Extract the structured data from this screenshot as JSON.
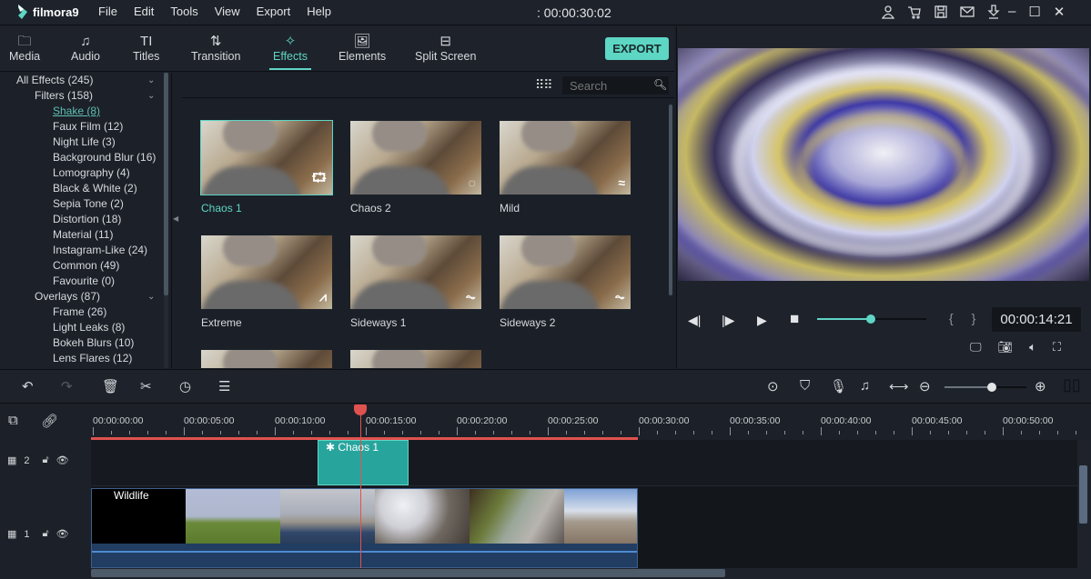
{
  "app": {
    "name": "filmora9",
    "project_duration": ": 00:00:30:02"
  },
  "menu": [
    "File",
    "Edit",
    "Tools",
    "View",
    "Export",
    "Help"
  ],
  "top_icons": [
    "account-icon",
    "cart-icon",
    "save-icon",
    "mail-icon",
    "download-icon"
  ],
  "window_controls": {
    "minimize": "–",
    "maximize": "☐",
    "close": "✕"
  },
  "tabs": [
    {
      "label": "Media",
      "icon": "folder-icon",
      "glyph": "🗀"
    },
    {
      "label": "Audio",
      "icon": "music-note-icon",
      "glyph": "♫"
    },
    {
      "label": "Titles",
      "icon": "text-icon",
      "glyph": "TI"
    },
    {
      "label": "Transition",
      "icon": "transition-icon",
      "glyph": "⇅"
    },
    {
      "label": "Effects",
      "icon": "effects-star-icon",
      "glyph": "✧",
      "active": true
    },
    {
      "label": "Elements",
      "icon": "image-icon",
      "glyph": "🖼"
    },
    {
      "label": "Split Screen",
      "icon": "split-screen-icon",
      "glyph": "⊟"
    }
  ],
  "export_label": "EXPORT",
  "sidebar": {
    "items": [
      {
        "label": "All Effects (245)",
        "level": 0,
        "expandable": true
      },
      {
        "label": "Filters (158)",
        "level": 1,
        "expandable": true
      },
      {
        "label": "Shake (8)",
        "level": 2,
        "selected": true
      },
      {
        "label": "Faux Film (12)",
        "level": 2
      },
      {
        "label": "Night Life (3)",
        "level": 2
      },
      {
        "label": "Background Blur (16)",
        "level": 2
      },
      {
        "label": "Lomography (4)",
        "level": 2
      },
      {
        "label": "Black & White (2)",
        "level": 2
      },
      {
        "label": "Sepia Tone (2)",
        "level": 2
      },
      {
        "label": "Distortion (18)",
        "level": 2
      },
      {
        "label": "Material (11)",
        "level": 2
      },
      {
        "label": "Instagram-Like (24)",
        "level": 2
      },
      {
        "label": "Common (49)",
        "level": 2
      },
      {
        "label": "Favourite (0)",
        "level": 2
      },
      {
        "label": "Overlays (87)",
        "level": 1,
        "expandable": true
      },
      {
        "label": "Frame (26)",
        "level": 2
      },
      {
        "label": "Light Leaks (8)",
        "level": 2
      },
      {
        "label": "Bokeh Blurs (10)",
        "level": 2
      },
      {
        "label": "Lens Flares (12)",
        "level": 2
      }
    ]
  },
  "search": {
    "placeholder": "Search",
    "value": ""
  },
  "effects": [
    {
      "label": "Chaos 1",
      "glyph": "⮔",
      "selected": true
    },
    {
      "label": "Chaos 2",
      "glyph": "◌"
    },
    {
      "label": "Mild",
      "glyph": "≈"
    },
    {
      "label": "Extreme",
      "glyph": "⩘"
    },
    {
      "label": "Sideways 1",
      "glyph": "⏦"
    },
    {
      "label": "Sideways 2",
      "glyph": "⏦"
    },
    {
      "label": "",
      "glyph": ""
    },
    {
      "label": "",
      "glyph": ""
    }
  ],
  "player": {
    "timecode": "00:00:14:21",
    "progress": 0.49,
    "braces": "{ }"
  },
  "timeline": {
    "zoom_level": 0.58,
    "ruler": [
      "00:00:00:00",
      "00:00:05:00",
      "00:00:10:00",
      "00:00:15:00",
      "00:00:20:00",
      "00:00:25:00",
      "00:00:30:00",
      "00:00:35:00",
      "00:00:40:00",
      "00:00:45:00",
      "00:00:50:00"
    ],
    "tracks": [
      {
        "number": "2",
        "clips": [
          {
            "label": "Chaos 1",
            "type": "effect"
          }
        ]
      },
      {
        "number": "1",
        "clips": [
          {
            "label": "Wildlife",
            "type": "title"
          }
        ]
      }
    ]
  }
}
